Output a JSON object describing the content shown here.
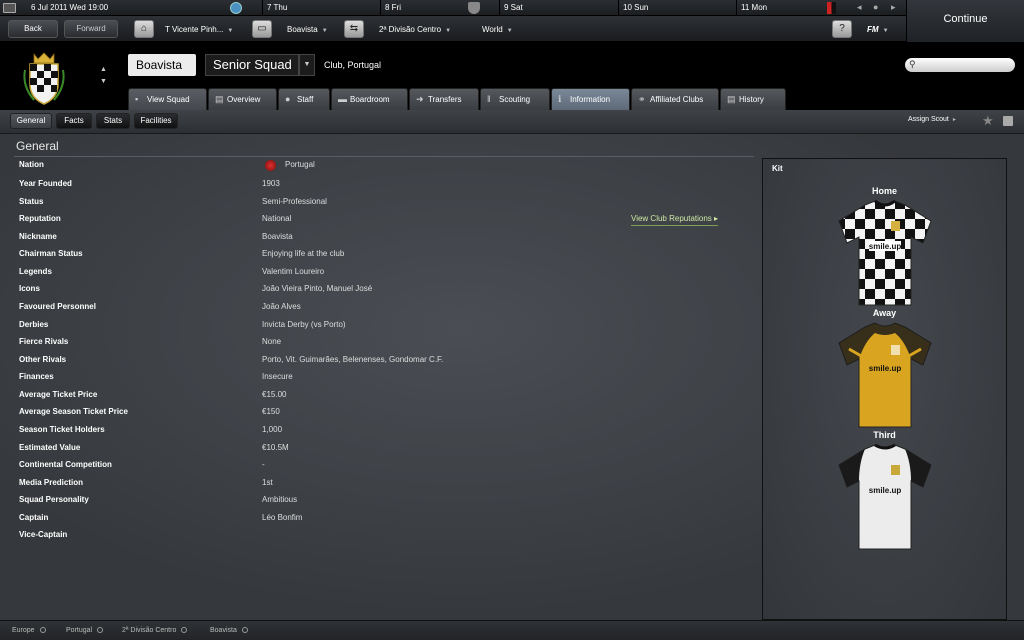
{
  "calendar": {
    "date": "6 Jul 2011  Wed  19:00",
    "days": [
      "7 Thu",
      "8 Fri",
      "9 Sat",
      "10 Sun",
      "11 Mon"
    ]
  },
  "continue_label": "Continue",
  "nav": {
    "back": "Back",
    "forward": "Forward",
    "manager": "T Vicente Pinh...",
    "club": "Boavista",
    "competition": "2ª Divisão Centro",
    "world": "World",
    "help": "?",
    "fm_logo": "FM"
  },
  "header": {
    "club_name": "Boavista",
    "squad": "Senior Squad",
    "subtitle": "Club, Portugal"
  },
  "tabs": [
    {
      "label": "View Squad",
      "icon": "squad-icon"
    },
    {
      "label": "Overview",
      "icon": "overview-icon"
    },
    {
      "label": "Staff",
      "icon": "staff-icon"
    },
    {
      "label": "Boardroom",
      "icon": "boardroom-icon"
    },
    {
      "label": "Transfers",
      "icon": "transfers-icon"
    },
    {
      "label": "Scouting",
      "icon": "scouting-icon"
    },
    {
      "label": "Information",
      "icon": "info-icon"
    },
    {
      "label": "Affiliated Clubs",
      "icon": "link-icon"
    },
    {
      "label": "History",
      "icon": "history-icon"
    }
  ],
  "subtabs": [
    "General",
    "Facts",
    "Stats",
    "Facilities"
  ],
  "assign_scout": "Assign Scout",
  "section_title": "General",
  "info_rows": [
    {
      "label": "Nation",
      "value": "Portugal"
    },
    {
      "label": "Year Founded",
      "value": "1903"
    },
    {
      "label": "Status",
      "value": "Semi-Professional"
    },
    {
      "label": "Reputation",
      "value": "National"
    },
    {
      "label": "Nickname",
      "value": "Boavista"
    },
    {
      "label": "Chairman Status",
      "value": "Enjoying life at the club"
    },
    {
      "label": "Legends",
      "value": "Valentim Loureiro"
    },
    {
      "label": "Icons",
      "value": "João Vieira Pinto, Manuel José"
    },
    {
      "label": "Favoured Personnel",
      "value": "João Alves"
    },
    {
      "label": "Derbies",
      "value": "Invicta Derby (vs Porto)"
    },
    {
      "label": "Fierce Rivals",
      "value": "None"
    },
    {
      "label": "Other Rivals",
      "value": "Porto, Vit. Guimarães, Belenenses, Gondomar C.F."
    },
    {
      "label": "Finances",
      "value": "Insecure"
    },
    {
      "label": "Average Ticket Price",
      "value": "€15.00"
    },
    {
      "label": "Average Season Ticket Price",
      "value": "€150"
    },
    {
      "label": "Season Ticket Holders",
      "value": "1,000"
    },
    {
      "label": "Estimated Value",
      "value": "€10.5M"
    },
    {
      "label": "Continental Competition",
      "value": "-"
    },
    {
      "label": "Media Prediction",
      "value": "1st"
    },
    {
      "label": "Squad Personality",
      "value": "Ambitious"
    },
    {
      "label": "Captain",
      "value": "Léo Bonfim"
    },
    {
      "label": "Vice-Captain",
      "value": ""
    }
  ],
  "view_reputations": "View Club Reputations",
  "kit": {
    "title": "Kit",
    "home": "Home",
    "away": "Away",
    "third": "Third",
    "sponsor": "smile.up"
  },
  "footer": [
    "Europe",
    "Portugal",
    "2ª Divisão Centro",
    "Boavista"
  ],
  "colors": {
    "active_tab": "#6e7b8b",
    "link_green": "#cfe8a5",
    "away_kit": "#d9a520"
  }
}
